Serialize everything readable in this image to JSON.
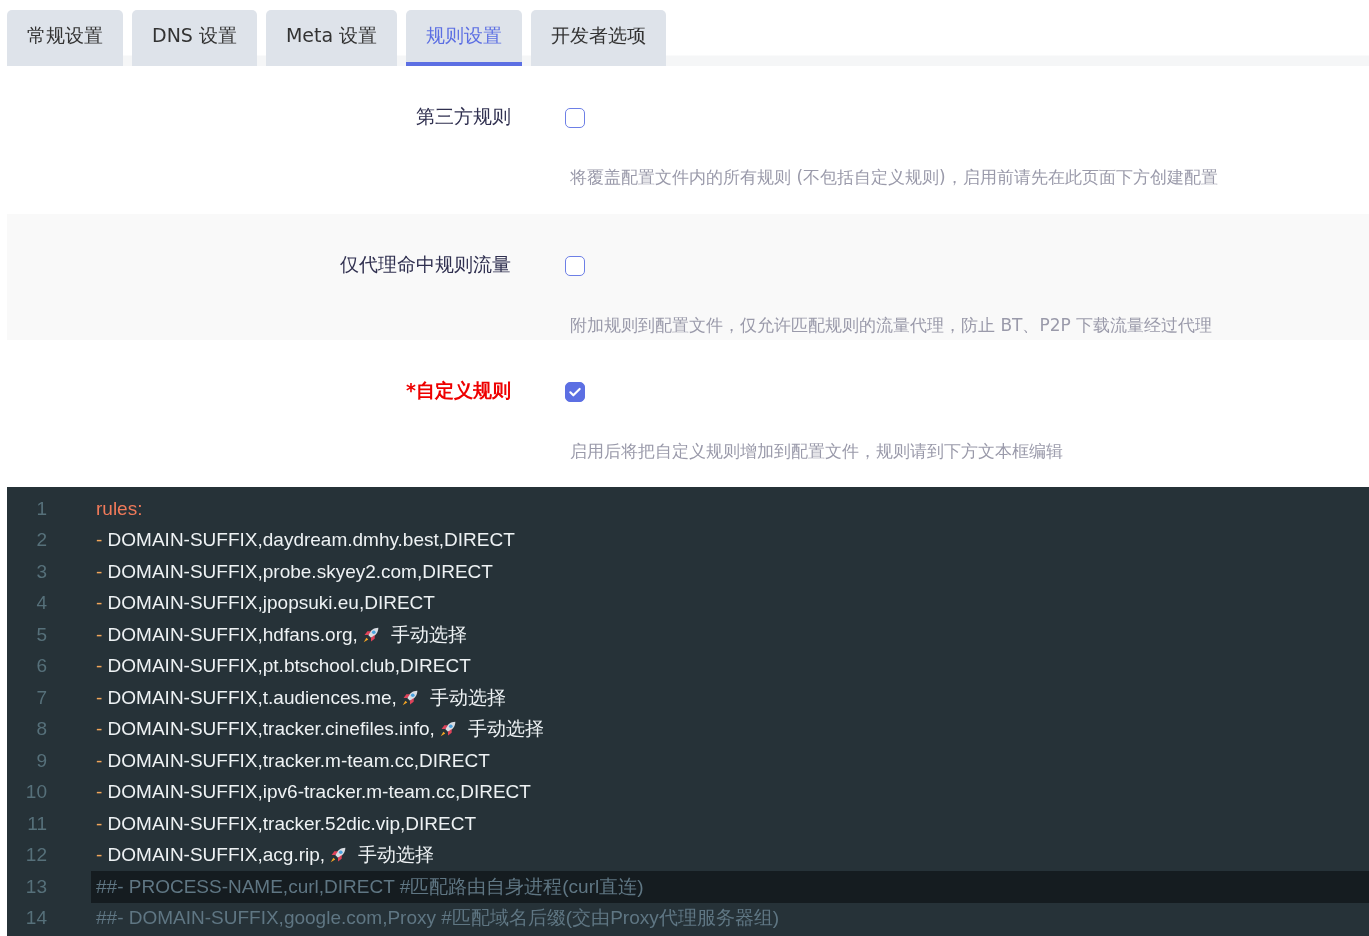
{
  "tabs": [
    {
      "label": "常规设置",
      "selected": false
    },
    {
      "label": "DNS 设置",
      "selected": false
    },
    {
      "label": "Meta 设置",
      "selected": false
    },
    {
      "label": "规则设置",
      "selected": true
    },
    {
      "label": "开发者选项",
      "selected": false
    }
  ],
  "settings": [
    {
      "label": "第三方规则",
      "required": false,
      "checked": false,
      "description": "将覆盖配置文件内的所有规则 (不包括自定义规则)，启用前请先在此页面下方创建配置"
    },
    {
      "label": "仅代理命中规则流量",
      "required": false,
      "checked": false,
      "description": "附加规则到配置文件，仅允许匹配规则的流量代理，防止 BT、P2P 下载流量经过代理"
    },
    {
      "label": "*自定义规则",
      "required": true,
      "checked": true,
      "description": "启用后将把自定义规则增加到配置文件，规则请到下方文本框编辑"
    }
  ],
  "editor": {
    "lines": [
      {
        "number": "1",
        "kind": "key",
        "text": "rules:",
        "active": false
      },
      {
        "number": "2",
        "kind": "item",
        "bullet": "-",
        "text": "DOMAIN-SUFFIX,daydream.dmhy.best,DIRECT",
        "active": false
      },
      {
        "number": "3",
        "kind": "item",
        "bullet": "-",
        "text": "DOMAIN-SUFFIX,probe.skyey2.com,DIRECT",
        "active": false
      },
      {
        "number": "4",
        "kind": "item",
        "bullet": "-",
        "text": "DOMAIN-SUFFIX,jpopsuki.eu,DIRECT",
        "active": false
      },
      {
        "number": "5",
        "kind": "item",
        "bullet": "-",
        "text": "DOMAIN-SUFFIX,hdfans.org,",
        "rocket": true,
        "after": "手动选择",
        "active": false
      },
      {
        "number": "6",
        "kind": "item",
        "bullet": "-",
        "text": "DOMAIN-SUFFIX,pt.btschool.club,DIRECT",
        "active": false
      },
      {
        "number": "7",
        "kind": "item",
        "bullet": "-",
        "text": "DOMAIN-SUFFIX,t.audiences.me,",
        "rocket": true,
        "after": "手动选择",
        "active": false
      },
      {
        "number": "8",
        "kind": "item",
        "bullet": "-",
        "text": "DOMAIN-SUFFIX,tracker.cinefiles.info,",
        "rocket": true,
        "after": "手动选择",
        "active": false
      },
      {
        "number": "9",
        "kind": "item",
        "bullet": "-",
        "text": "DOMAIN-SUFFIX,tracker.m-team.cc,DIRECT",
        "active": false
      },
      {
        "number": "10",
        "kind": "item",
        "bullet": "-",
        "text": "DOMAIN-SUFFIX,ipv6-tracker.m-team.cc,DIRECT",
        "active": false
      },
      {
        "number": "11",
        "kind": "item",
        "bullet": "-",
        "text": "DOMAIN-SUFFIX,tracker.52dic.vip,DIRECT",
        "active": false
      },
      {
        "number": "12",
        "kind": "item",
        "bullet": "-",
        "text": "DOMAIN-SUFFIX,acg.rip,",
        "rocket": true,
        "after": "手动选择",
        "active": false
      },
      {
        "number": "13",
        "kind": "comment",
        "text": "##- PROCESS-NAME,curl,DIRECT #匹配路由自身进程(curl直连)",
        "active": true
      },
      {
        "number": "14",
        "kind": "comment",
        "text": "##- DOMAIN-SUFFIX,google.com,Proxy #匹配域名后缀(交由Proxy代理服务器组)",
        "active": false
      }
    ]
  }
}
